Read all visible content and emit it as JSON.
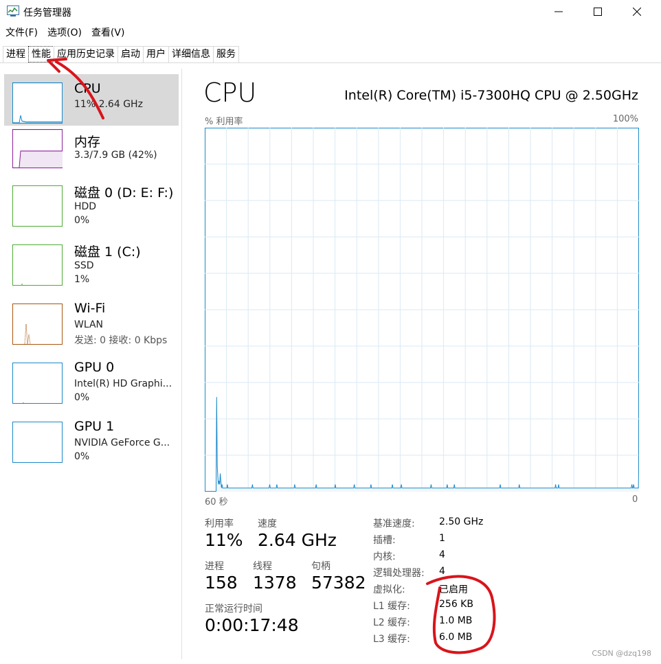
{
  "window": {
    "title": "任务管理器"
  },
  "menu": [
    "文件(F)",
    "选项(O)",
    "查看(V)"
  ],
  "tabs": [
    {
      "label": "进程",
      "active": false
    },
    {
      "label": "性能",
      "active": true
    },
    {
      "label": "应用历史记录",
      "active": false
    },
    {
      "label": "启动",
      "active": false
    },
    {
      "label": "用户",
      "active": false
    },
    {
      "label": "详细信息",
      "active": false
    },
    {
      "label": "服务",
      "active": false
    }
  ],
  "sidebar": {
    "items": [
      {
        "title": "CPU",
        "line1": "11% 2.64 GHz",
        "line2": "",
        "color": "#1a88c9",
        "selected": true
      },
      {
        "title": "内存",
        "line1": "3.3/7.9 GB (42%)",
        "line2": "",
        "color": "#8b1f9b",
        "selected": false
      },
      {
        "title": "磁盘 0 (D: E: F:)",
        "line1": "HDD",
        "line2": "0%",
        "color": "#4daa34",
        "selected": false
      },
      {
        "title": "磁盘 1 (C:)",
        "line1": "SSD",
        "line2": "1%",
        "color": "#4daa34",
        "selected": false
      },
      {
        "title": "Wi-Fi",
        "line1": "WLAN",
        "line2": "发送: 0 接收: 0 Kbps",
        "color": "#a8550e",
        "selected": false
      },
      {
        "title": "GPU 0",
        "line1": "Intel(R) HD Graphi...",
        "line2": "0%",
        "color": "#1a88c9",
        "selected": false
      },
      {
        "title": "GPU 1",
        "line1": "NVIDIA GeForce G...",
        "line2": "0%",
        "color": "#1a88c9",
        "selected": false
      }
    ]
  },
  "main": {
    "title": "CPU",
    "model": "Intel(R) Core(TM) i5-7300HQ CPU @ 2.50GHz",
    "y_label": "% 利用率",
    "y_max": "100%",
    "x_left": "60 秒",
    "x_right": "0",
    "stats": {
      "util_label": "利用率",
      "util_value": "11%",
      "speed_label": "速度",
      "speed_value": "2.64 GHz",
      "proc_label": "进程",
      "proc_value": "158",
      "thread_label": "线程",
      "thread_value": "1378",
      "handle_label": "句柄",
      "handle_value": "57382",
      "uptime_label": "正常运行时间",
      "uptime_value": "0:00:17:48"
    },
    "details": [
      {
        "label": "基准速度:",
        "value": "2.50 GHz"
      },
      {
        "label": "插槽:",
        "value": "1"
      },
      {
        "label": "内核:",
        "value": "4"
      },
      {
        "label": "逻辑处理器:",
        "value": "4"
      },
      {
        "label": "虚拟化:",
        "value": "已启用"
      },
      {
        "label": "L1 缓存:",
        "value": "256 KB"
      },
      {
        "label": "L2 缓存:",
        "value": "1.0 MB"
      },
      {
        "label": "L3 缓存:",
        "value": "6.0 MB"
      }
    ]
  },
  "cpu_history_percent": [
    0,
    0,
    0,
    0,
    0,
    0,
    0,
    0,
    0,
    0,
    0,
    0,
    0,
    0,
    0,
    0,
    0,
    0,
    0,
    0,
    26,
    7,
    4,
    2,
    3,
    2,
    5,
    3,
    1,
    2,
    1,
    1,
    1,
    1,
    1,
    1,
    1,
    1,
    2,
    1,
    1,
    1,
    1,
    1,
    1,
    1,
    1,
    1,
    1,
    1,
    1,
    1,
    1,
    1,
    1,
    1,
    1,
    1,
    1,
    1,
    1,
    1,
    1,
    1,
    1,
    1,
    1,
    1,
    1,
    1,
    1,
    1,
    1,
    1,
    1,
    1,
    1,
    1,
    1,
    1,
    2,
    1,
    1,
    1,
    1,
    1,
    1,
    1,
    1,
    1,
    1,
    1,
    1,
    1,
    1,
    1,
    1,
    1,
    1,
    1,
    1,
    1,
    1,
    1,
    1,
    1,
    1,
    1,
    1,
    2,
    1,
    1,
    1,
    1,
    1,
    1,
    1,
    1,
    1,
    1,
    1,
    2,
    1,
    1,
    1,
    1,
    1,
    1,
    1,
    1,
    1,
    1,
    1,
    1,
    1,
    1,
    1,
    1,
    1,
    1,
    1,
    1,
    1,
    1,
    1,
    1,
    1,
    1,
    1,
    1,
    1,
    2,
    1,
    1,
    1,
    1,
    1,
    1,
    1,
    1,
    1,
    1,
    1,
    1,
    1,
    1,
    1,
    1,
    1,
    1,
    1,
    1,
    1,
    1,
    1,
    1,
    1,
    1,
    1,
    1,
    1,
    1,
    1,
    1,
    1,
    1,
    1,
    2,
    1,
    1,
    1,
    1,
    1,
    1,
    1,
    1,
    1,
    1,
    1,
    1,
    1,
    1,
    1,
    1,
    1,
    1,
    1,
    1,
    1,
    1,
    1,
    1,
    1,
    1,
    1,
    1,
    1,
    1,
    1,
    2,
    1,
    1,
    1,
    1,
    1,
    1,
    1,
    1,
    1,
    1,
    1,
    1,
    1,
    1,
    1,
    1,
    1,
    1,
    1,
    1,
    1,
    1,
    1,
    1,
    1,
    1,
    1,
    1,
    1,
    1,
    1,
    2,
    1,
    1,
    1,
    1,
    1,
    1,
    1,
    1,
    1,
    1,
    1,
    1,
    1,
    1,
    1,
    1,
    1,
    1,
    1,
    1,
    1,
    1,
    1,
    1,
    1,
    1,
    1,
    2,
    1,
    1,
    1,
    1,
    1,
    1,
    1,
    1,
    1,
    1,
    1,
    1,
    1,
    1,
    1,
    1,
    1,
    1,
    1,
    1,
    1,
    1,
    1,
    1,
    1,
    1,
    1,
    1,
    1,
    1,
    1,
    1,
    1,
    1,
    1,
    2,
    1,
    1,
    1,
    1,
    1,
    1,
    1,
    1,
    1,
    1,
    1,
    1,
    1,
    1,
    2,
    1,
    1,
    1,
    1,
    1,
    1,
    1,
    1,
    1,
    1,
    1,
    1,
    1,
    1,
    1,
    1,
    1,
    1,
    1,
    1,
    1,
    1,
    1,
    1,
    1,
    1,
    1,
    1,
    1,
    1,
    1,
    1,
    1,
    1,
    1,
    1,
    1,
    1,
    1,
    1,
    1,
    1,
    1,
    1,
    1,
    1,
    1,
    1,
    1,
    2,
    1,
    1,
    1,
    1,
    1,
    1,
    1,
    1,
    1,
    1,
    1,
    1,
    1,
    1,
    1,
    1,
    1,
    1,
    1,
    1,
    1,
    1,
    1,
    1,
    1,
    1,
    2,
    1,
    1,
    1,
    1,
    1,
    1,
    1,
    1,
    1,
    1,
    1,
    2,
    1,
    1,
    1,
    1,
    1,
    1,
    1,
    1,
    1,
    1,
    1,
    1,
    1,
    1,
    1,
    1,
    1,
    1,
    1,
    1,
    1,
    1,
    1,
    1,
    1,
    1,
    1,
    1,
    1,
    1,
    1,
    1,
    1,
    1,
    1,
    1,
    1,
    1,
    1,
    1,
    1,
    1,
    1,
    1,
    1,
    1,
    1,
    1,
    1,
    1,
    1,
    1,
    1,
    1,
    1,
    1,
    1,
    1,
    1,
    1,
    1,
    1,
    1,
    1,
    1,
    1,
    1,
    1,
    1,
    1,
    1,
    1,
    1,
    1,
    1,
    1,
    2,
    1,
    1,
    1,
    1,
    1,
    1,
    1,
    1,
    1,
    1,
    1,
    1,
    1,
    1,
    1,
    1,
    1,
    1,
    1,
    1,
    1,
    1,
    1,
    1,
    1,
    1,
    1,
    1,
    1,
    1,
    1,
    2,
    1,
    1,
    1,
    1,
    1,
    1,
    1,
    1,
    1,
    1,
    1,
    1,
    1,
    1,
    1,
    1,
    1,
    1,
    1,
    1,
    1,
    1,
    1,
    1,
    1,
    1,
    1,
    1,
    1,
    1,
    1,
    1,
    1,
    1,
    1,
    1,
    1,
    1,
    1,
    1,
    1,
    1,
    1,
    1,
    1,
    1,
    1,
    1,
    1,
    1,
    1,
    1,
    1,
    1,
    1,
    1,
    1,
    1,
    1,
    1,
    2,
    1,
    1,
    1,
    1,
    2,
    1,
    1,
    1,
    1,
    1,
    1,
    1,
    1,
    1,
    1,
    1,
    1,
    1,
    1,
    1,
    1,
    1,
    1,
    1,
    1,
    1,
    1,
    1,
    1,
    1,
    1,
    1,
    1,
    1,
    1,
    1,
    1,
    1,
    1,
    1,
    1,
    1,
    1,
    1,
    1,
    1,
    1,
    1,
    1,
    1,
    1,
    1,
    1,
    1,
    1,
    1,
    1,
    1,
    1,
    1,
    1,
    1,
    1,
    1,
    1,
    1,
    1,
    1,
    1,
    1,
    1,
    1,
    1,
    1,
    1,
    1,
    1,
    1,
    1,
    1,
    1,
    1,
    1,
    1,
    1,
    1,
    1,
    1,
    1,
    1,
    1,
    1,
    1,
    1,
    1,
    1,
    1,
    1,
    1,
    1,
    1,
    1,
    1,
    1,
    1,
    1,
    1,
    1,
    1,
    1,
    1,
    1,
    1,
    1,
    1,
    1,
    1,
    1,
    1,
    1,
    1,
    1,
    1,
    1,
    1,
    1,
    1,
    2,
    1,
    1,
    2,
    1,
    1,
    1,
    1,
    1,
    1,
    1,
    1,
    11
  ],
  "annotation_colors": {
    "ink": "#d9141b"
  },
  "watermark": "CSDN @dzq198"
}
